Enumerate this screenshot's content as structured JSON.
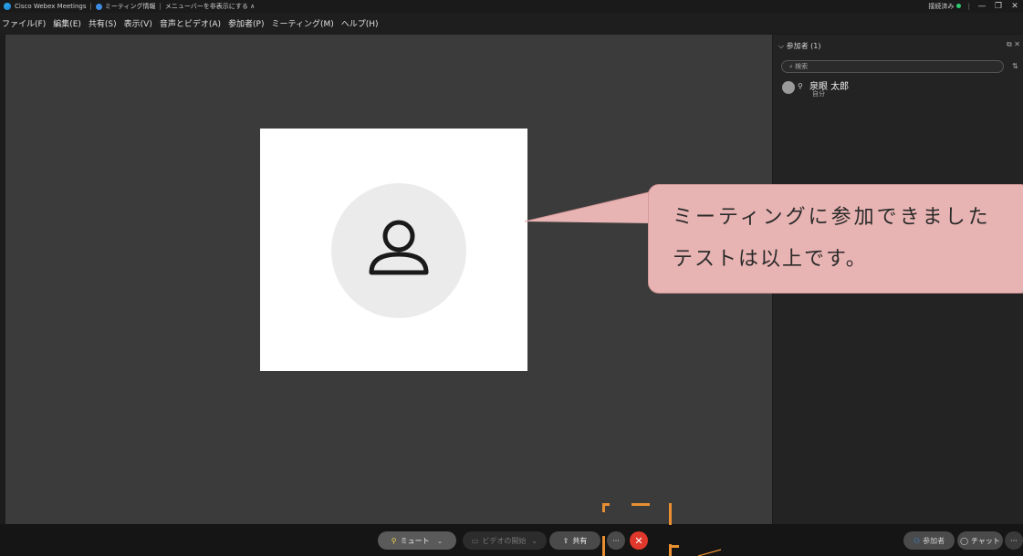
{
  "titlebar": {
    "app_name": "Cisco Webex Meetings",
    "meeting_info": "ミーティング情報",
    "hide_menu": "メニューバーを非表示にする ∧",
    "status": "接続済み",
    "minimize": "—",
    "restore": "❐",
    "close": "✕"
  },
  "menu": [
    "ファイル(F)",
    "編集(E)",
    "共有(S)",
    "表示(V)",
    "音声とビデオ(A)",
    "参加者(P)",
    "ミーティング(M)",
    "ヘルプ(H)"
  ],
  "callout": {
    "line1": "ミーティングに参加できました",
    "line2": "テストは以上です。"
  },
  "panel": {
    "title": "参加者 (1)",
    "search_placeholder": "検索",
    "participant_name": "泉眼 太郎",
    "participant_role": "自分"
  },
  "controls": {
    "mute": "ミュート",
    "start_video": "ビデオの開始",
    "share": "共有",
    "more": "···",
    "leave": "✕",
    "participants": "参加者",
    "chat": "チャット",
    "more_right": "···"
  },
  "colors": {
    "accent_blue": "#3c8de6",
    "leave_red": "#e0382c",
    "callout_pink": "#e8b4b3",
    "highlight_orange": "#e98f32"
  }
}
